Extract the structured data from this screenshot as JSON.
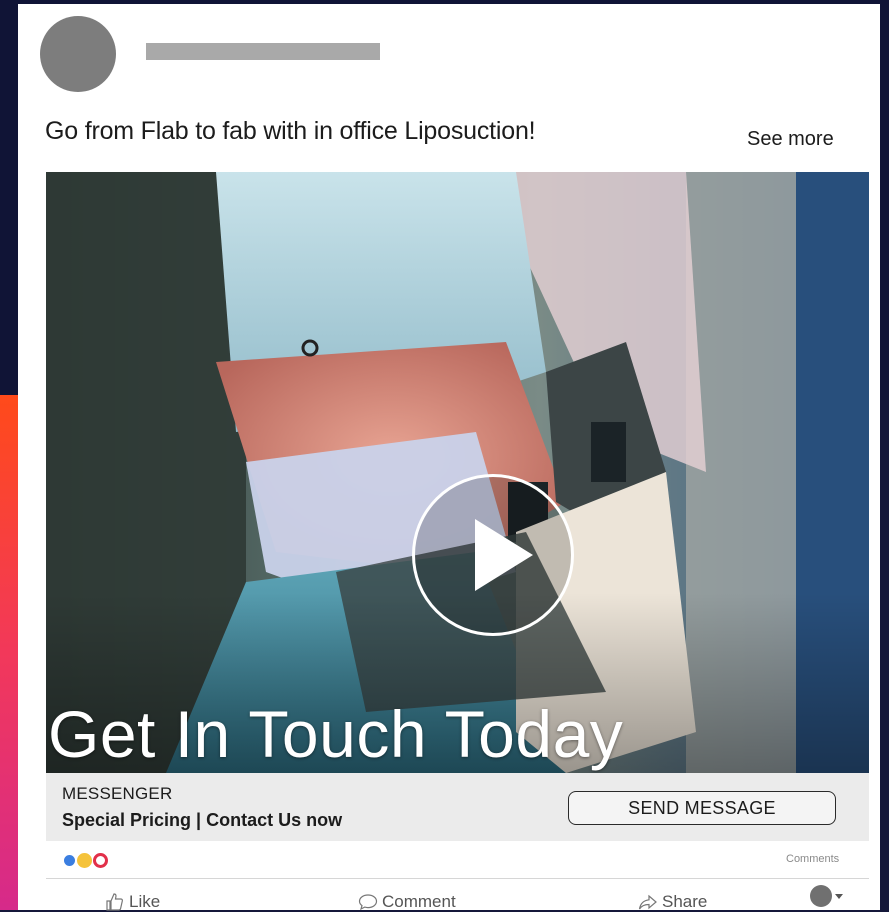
{
  "post": {
    "text": "Go from Flab to fab with in office Liposuction!",
    "see_more": "See more"
  },
  "media": {
    "overlay_text": "Get In Touch Today",
    "play_icon": "play-icon"
  },
  "cta": {
    "label": "MESSENGER",
    "description": "Special Pricing | Contact Us now",
    "button": "SEND MESSAGE"
  },
  "engagement": {
    "reactions": [
      "like",
      "wow",
      "love"
    ],
    "comments_label": "Comments"
  },
  "actions": {
    "like": "Like",
    "comment": "Comment",
    "share": "Share"
  },
  "colors": {
    "background": "#101436",
    "side_gradient_top": "#ff4a1a",
    "side_gradient_bottom": "#d62a8a",
    "cta_bar": "#ebebeb",
    "reaction_like": "#3b7ee0",
    "reaction_wow": "#f5c33b",
    "reaction_love": "#e2304a"
  }
}
